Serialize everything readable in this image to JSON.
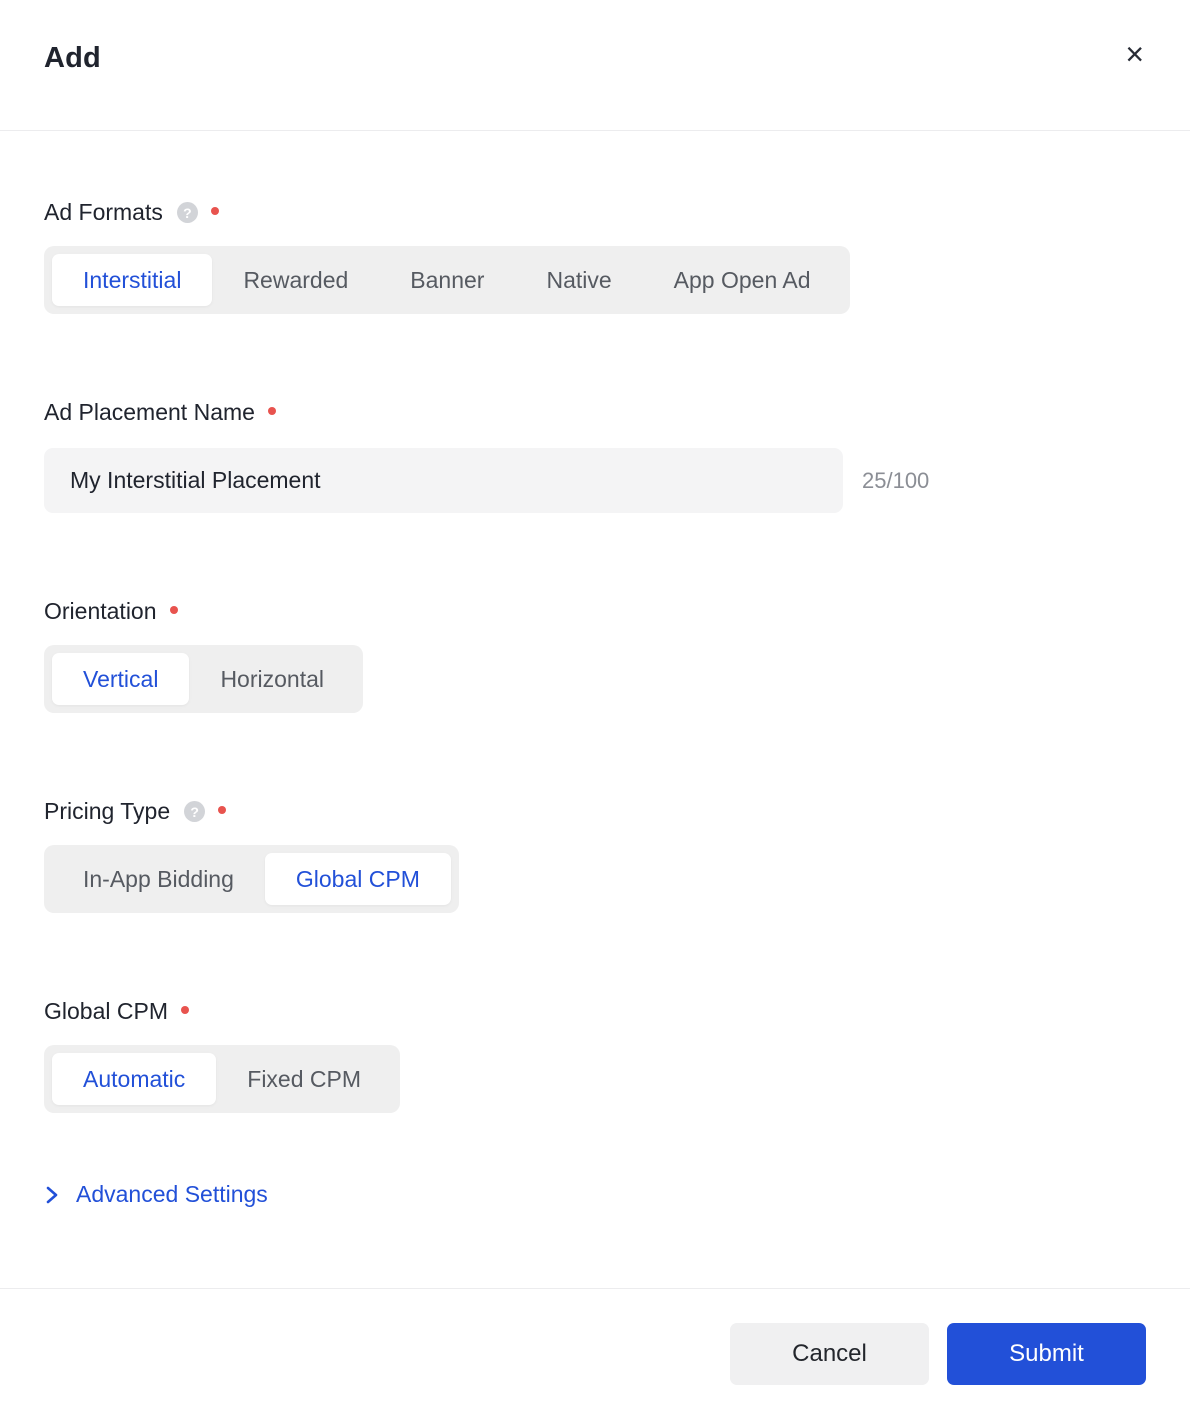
{
  "header": {
    "title": "Add"
  },
  "icons": {
    "close": "×",
    "help": "?"
  },
  "form": {
    "ad_formats": {
      "label": "Ad Formats",
      "options": [
        "Interstitial",
        "Rewarded",
        "Banner",
        "Native",
        "App Open Ad"
      ],
      "selected": "Interstitial"
    },
    "ad_placement_name": {
      "label": "Ad Placement Name",
      "value": "My Interstitial Placement",
      "counter": "25/100"
    },
    "orientation": {
      "label": "Orientation",
      "options": [
        "Vertical",
        "Horizontal"
      ],
      "selected": "Vertical"
    },
    "pricing_type": {
      "label": "Pricing Type",
      "options": [
        "In-App Bidding",
        "Global CPM"
      ],
      "selected": "Global CPM"
    },
    "global_cpm": {
      "label": "Global CPM",
      "options": [
        "Automatic",
        "Fixed CPM"
      ],
      "selected": "Automatic"
    },
    "advanced_settings": {
      "label": "Advanced Settings"
    }
  },
  "footer": {
    "cancel_label": "Cancel",
    "submit_label": "Submit"
  },
  "colors": {
    "accent": "#2250d8",
    "required_dot": "#e8534e",
    "track_bg": "#efefef",
    "input_bg": "#f4f4f5"
  }
}
